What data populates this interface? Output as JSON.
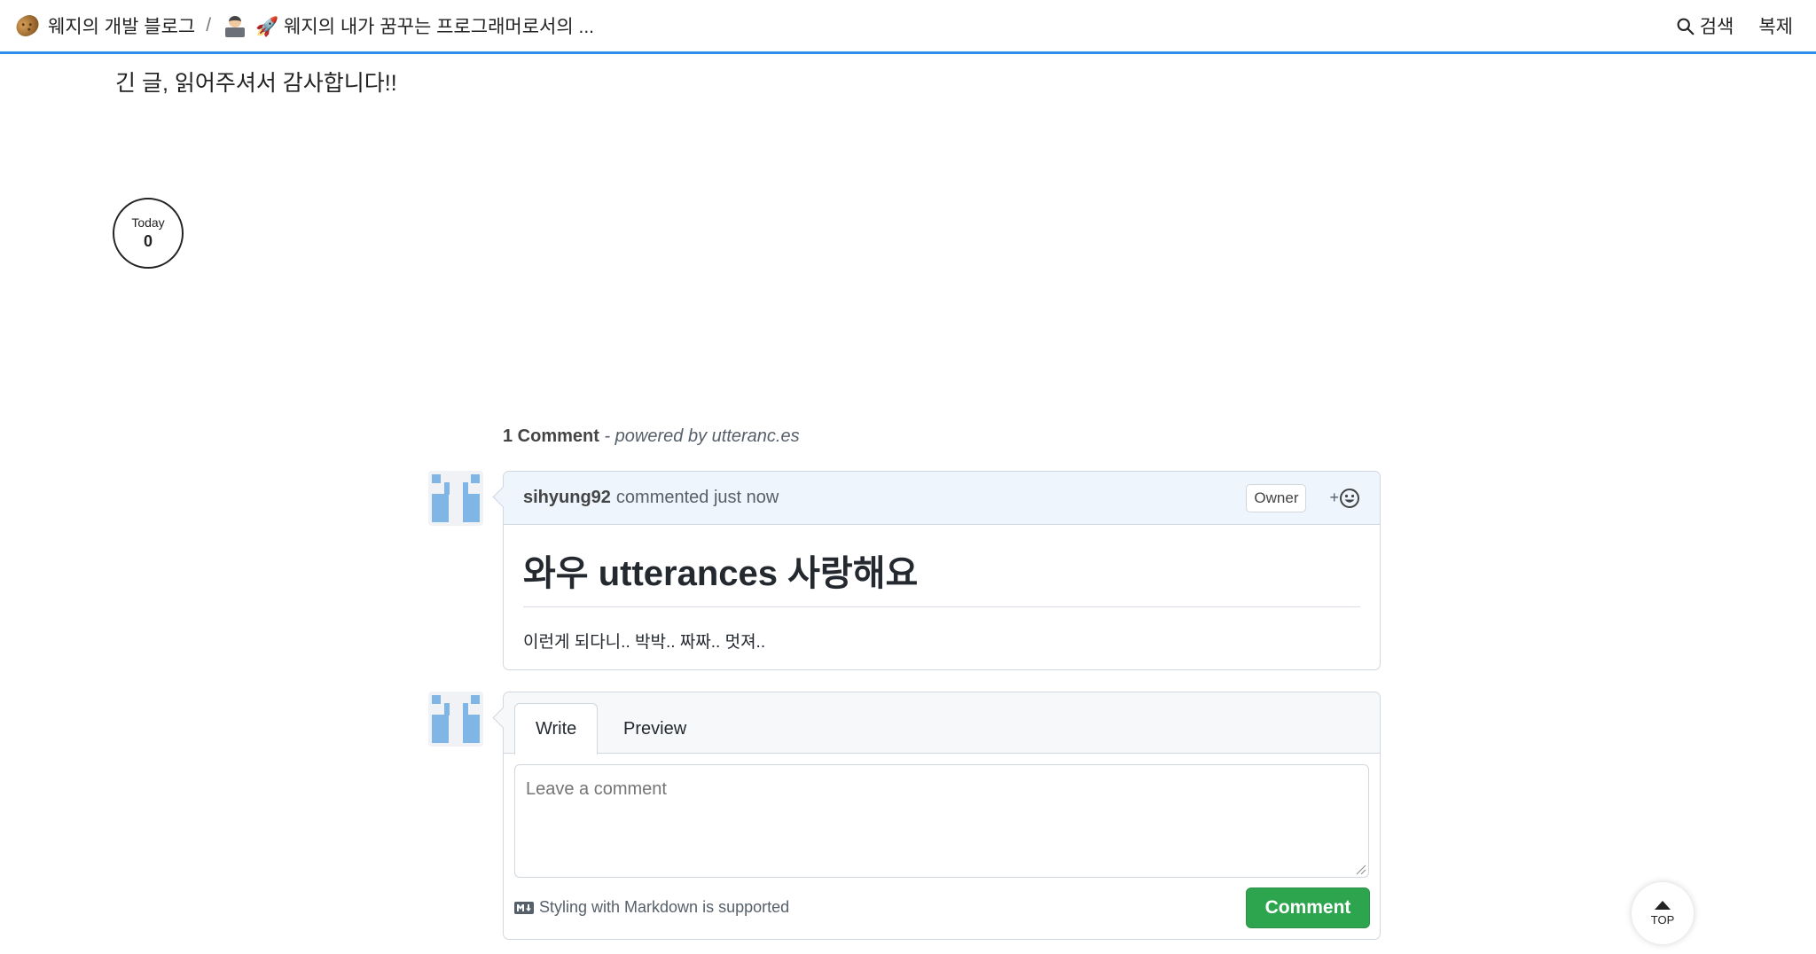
{
  "header": {
    "blog_title": "웨지의 개발 블로그",
    "separator": "/",
    "post_title": "🚀 웨지의 내가 꿈꾸는 프로그래머로서의 ...",
    "search_label": "검색",
    "copy_label": "복제",
    "accent_color": "#2f8ded"
  },
  "article": {
    "closing_text": "긴 글, 읽어주셔서 감사합니다!!"
  },
  "visit_counter": {
    "label": "Today",
    "count": "0"
  },
  "comments": {
    "count_label": "1 Comment",
    "powered_by": " - powered by utteranc.es",
    "items": [
      {
        "author": "sihyung92",
        "action": "commented just now",
        "badge": "Owner",
        "reaction_plus": "+",
        "heading": "와우 utterances 사랑해요",
        "body": "이런게 되다니.. 박박.. 짜짜.. 멋져.."
      }
    ],
    "editor": {
      "tab_write": "Write",
      "tab_preview": "Preview",
      "placeholder": "Leave a comment",
      "markdown_note": "Styling with Markdown is supported",
      "submit_label": "Comment",
      "submit_color": "#2da44e"
    }
  },
  "scroll_top": {
    "label": "TOP"
  }
}
